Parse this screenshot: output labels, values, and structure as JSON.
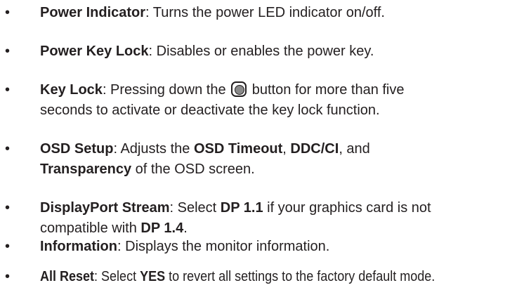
{
  "items": [
    {
      "term": "Power Indicator",
      "sep": ":",
      "desc": " Turns the power LED indicator on/off."
    },
    {
      "term": "Power Key Lock",
      "sep": ":",
      "desc": " Disables or enables the power key."
    },
    {
      "term": "Key Lock",
      "sep": ":",
      "desc_before": " Pressing down the ",
      "icon": "joystick-button-icon",
      "desc_after": " button for more than five",
      "desc_line2": "seconds to activate or deactivate the key lock function."
    },
    {
      "term": "OSD Setup",
      "sep": ":",
      "desc1": " Adjusts the ",
      "b1": "OSD Timeout",
      "desc2": ", ",
      "b2": "DDC/CI",
      "desc3": ", and",
      "b3": "Transparency",
      "desc4": " of the OSD screen."
    },
    {
      "term": "DisplayPort Stream",
      "sep": ":",
      "desc1": " Select ",
      "b1": "DP 1.1",
      "desc2": " if your graphics card is not",
      "desc3": "compatible with ",
      "b2": "DP 1.4",
      "desc4": "."
    },
    {
      "term": "Information",
      "sep": ":",
      "desc": " Displays the monitor information."
    },
    {
      "term": "All Reset",
      "sep": ":",
      "desc1": " Select ",
      "b1": "YES",
      "desc2": " to revert all settings to the factory default mode."
    }
  ],
  "bullet": "•"
}
